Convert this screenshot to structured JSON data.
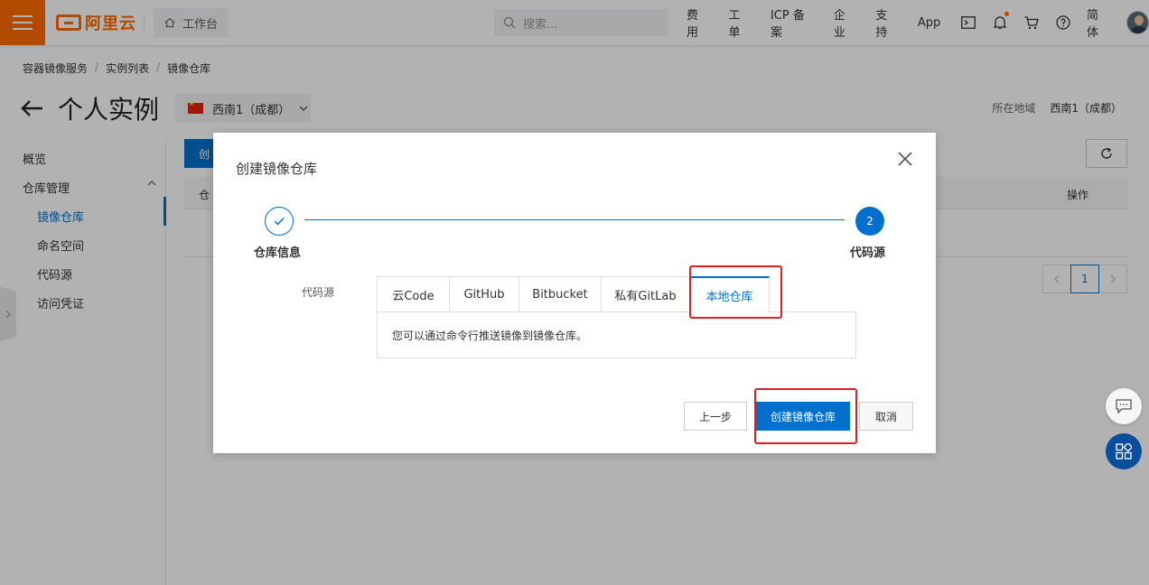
{
  "topbar": {
    "logo_text": "阿里云",
    "workbench_label": "工作台",
    "search_placeholder": "搜索...",
    "links": [
      "费用",
      "工单",
      "ICP 备案",
      "企业",
      "支持",
      "App"
    ],
    "language_label": "简体",
    "brand_color": "#ff6a00"
  },
  "breadcrumb": [
    "容器镜像服务",
    "实例列表",
    "镜像仓库"
  ],
  "header": {
    "title": "个人实例",
    "region_selected": "西南1（成都）",
    "region_info_label": "所在地域",
    "region_info_value": "西南1（成都）"
  },
  "sidebar": {
    "overview": "概览",
    "repo_management": "仓库管理",
    "items": [
      "镜像仓库",
      "命名空间",
      "代码源",
      "访问凭证"
    ]
  },
  "main": {
    "create_button_partial": "创",
    "table_col_first_partial": "仓",
    "table_col_actions": "操作",
    "current_page": "1"
  },
  "dialog": {
    "title": "创建镜像仓库",
    "steps": [
      {
        "label": "仓库信息",
        "status": "done"
      },
      {
        "label": "代码源",
        "number": "2",
        "status": "active"
      }
    ],
    "source_field_label": "代码源",
    "source_tabs": [
      "云Code",
      "GitHub",
      "Bitbucket",
      "私有GitLab",
      "本地仓库"
    ],
    "active_tab": "本地仓库",
    "tab_description": "您可以通过命令行推送镜像到镜像仓库。",
    "prev_button": "上一步",
    "create_button": "创建镜像仓库",
    "cancel_button": "取消"
  },
  "colors": {
    "primary": "#0070cc",
    "highlight": "#e02020"
  }
}
